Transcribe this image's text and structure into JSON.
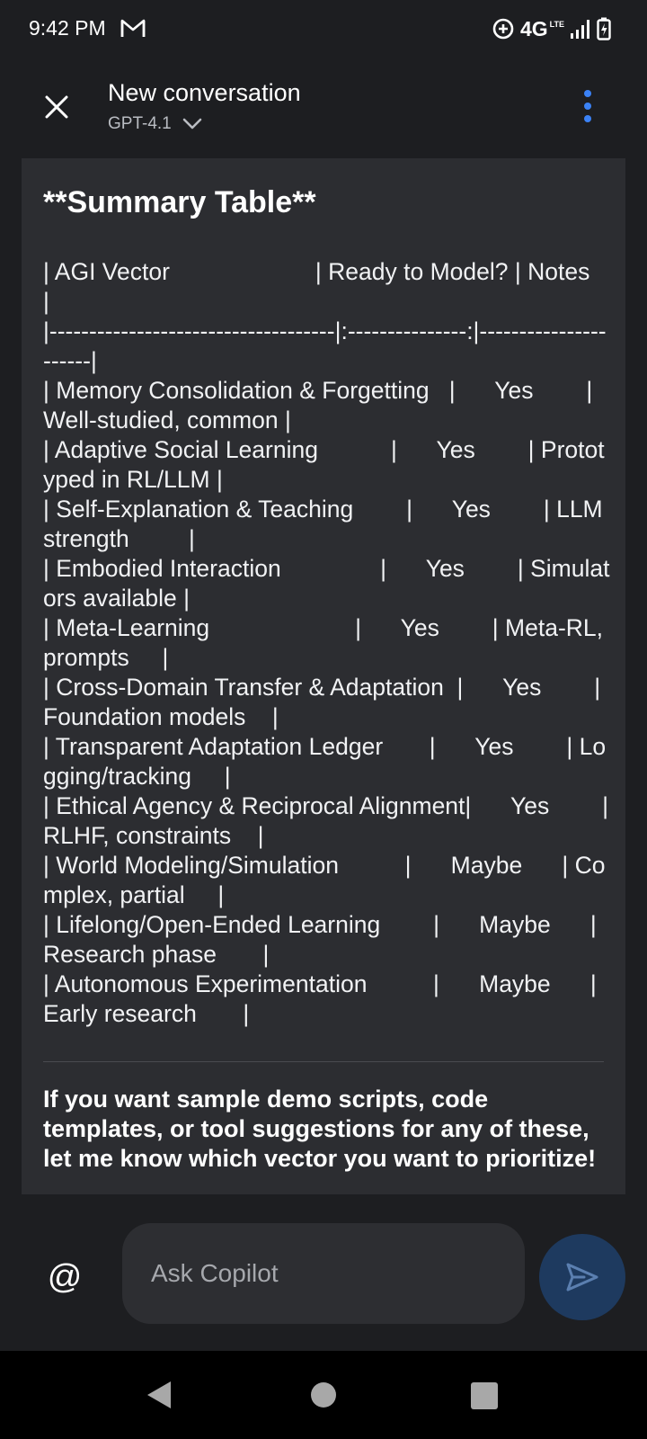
{
  "status_bar": {
    "time": "9:42 PM",
    "notification_icon": "gmail-icon",
    "network": "4G",
    "network_sub": "LTE",
    "icons": [
      "data-saver-icon",
      "signal-icon",
      "battery-charging-icon"
    ]
  },
  "header": {
    "title": "New conversation",
    "model": "GPT-4.1",
    "icons": [
      "close-icon",
      "chevron-down-icon",
      "more-vertical-icon"
    ],
    "accent_color": "#3b82f6"
  },
  "message": {
    "heading": "**Summary Table**",
    "table_text": "| AGI Vector                      | Ready to Model? | Notes               |\n|------------------------------------|:---------------:|----------------------|\n| Memory Consolidation & Forgetting   |      Yes        | Well-studied, common |\n| Adaptive Social Learning           |      Yes        | Prototyped in RL/LLM |\n| Self-Explanation & Teaching        |      Yes        | LLM strength         |\n| Embodied Interaction               |      Yes        | Simulators available |\n| Meta-Learning                      |      Yes        | Meta-RL, prompts     |\n| Cross-Domain Transfer & Adaptation  |      Yes        | Foundation models    |\n| Transparent Adaptation Ledger       |      Yes        | Logging/tracking     |\n| Ethical Agency & Reciprocal Alignment|      Yes        | RLHF, constraints    |\n| World Modeling/Simulation          |      Maybe      | Complex, partial     |\n| Lifelong/Open-Ended Learning        |      Maybe      | Research phase       |\n| Autonomous Experimentation          |      Maybe      | Early research       |",
    "followup": "If you want sample demo scripts, code templates, or tool suggestions for any of these, let me know which vector you want to prioritize!"
  },
  "composer": {
    "placeholder": "Ask Copilot",
    "mention_symbol": "@",
    "icons": [
      "at-sign-icon",
      "send-icon"
    ],
    "send_color": "#1e3a5f"
  },
  "nav_bar": {
    "icons": [
      "back-icon",
      "home-icon",
      "recents-icon"
    ]
  }
}
